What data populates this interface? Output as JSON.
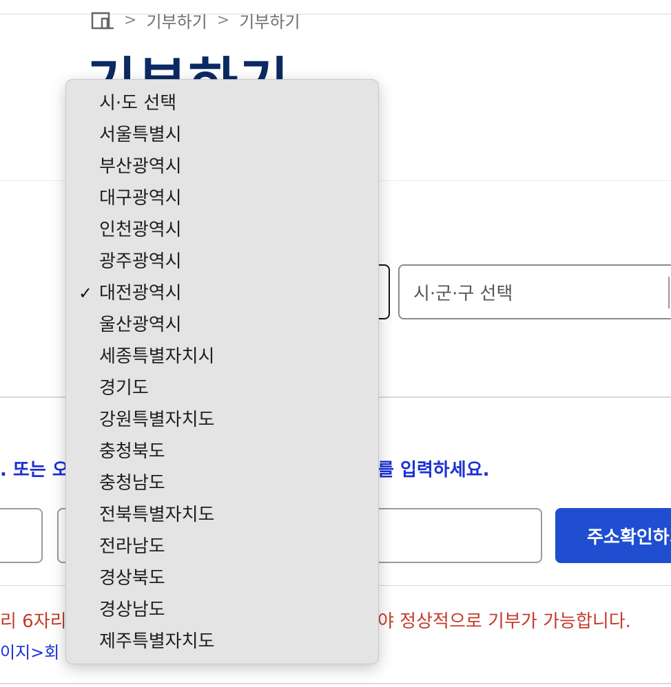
{
  "breadcrumb": {
    "items": [
      "기부하기",
      "기부하기"
    ],
    "separator": ">"
  },
  "page": {
    "title": "기부하기"
  },
  "region": {
    "selected": "대전광역시",
    "sigungu_placeholder": "시·군·구 선택",
    "options": [
      "시·도 선택",
      "서울특별시",
      "부산광역시",
      "대구광역시",
      "인천광역시",
      "광주광역시",
      "대전광역시",
      "울산광역시",
      "세종특별자치시",
      "경기도",
      "강원특별자치도",
      "충청북도",
      "충청남도",
      "전북특별자치도",
      "전라남도",
      "경상북도",
      "경상남도",
      "제주특별자치도"
    ]
  },
  "address": {
    "hint_left": ". 또는 오",
    "hint_right": "를 입력하세요.",
    "confirm_label": "주소확인하기"
  },
  "notice": {
    "red_left": "리 6자리",
    "red_right": "야 정상적으로 기부가 가능합니다.",
    "link_text": "이지>회"
  },
  "colors": {
    "title": "#0b2a63",
    "accent": "#1f4fd0",
    "link": "#1a2fd6",
    "warning": "#c43a2c"
  }
}
